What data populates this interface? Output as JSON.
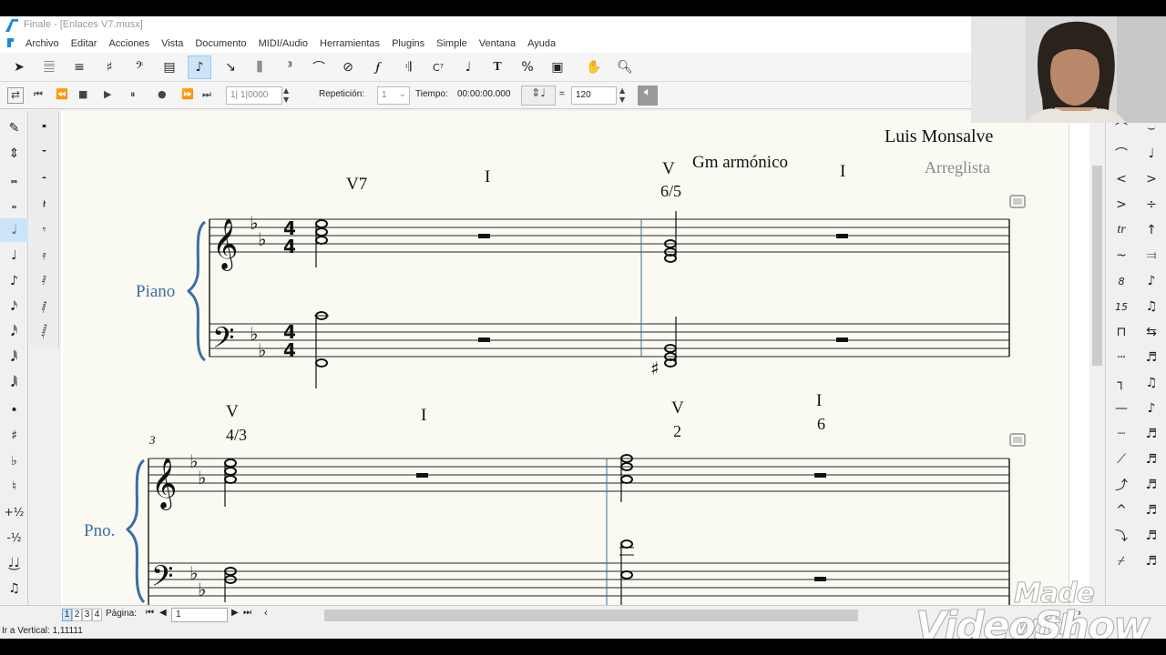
{
  "window": {
    "title": "Finale - [Enlaces V7.musx]"
  },
  "menu": {
    "items": [
      "Archivo",
      "Editar",
      "Acciones",
      "Vista",
      "Documento",
      "MIDI/Audio",
      "Herramientas",
      "Plugins",
      "Simple",
      "Ventana",
      "Ayuda"
    ]
  },
  "playback": {
    "counter": "1| 1|0000",
    "repeat_label": "Repetición:",
    "repeat_value": "1",
    "time_label": "Tiempo:",
    "time_value": "00:00:00.000",
    "equals": "=",
    "tempo": "120"
  },
  "score": {
    "composer": "Luis Monsalve",
    "arranger": "Arreglista",
    "instrument_full": "Piano",
    "instrument_short": "Pno.",
    "measure_number": "3",
    "key_text": "Gm armónico",
    "system1": {
      "chords": [
        {
          "label": "V7",
          "inversion": ""
        },
        {
          "label": "I",
          "inversion": ""
        },
        {
          "label": "V",
          "inversion": "6/5"
        },
        {
          "label": "I",
          "inversion": ""
        }
      ]
    },
    "system2": {
      "chords": [
        {
          "label": "V",
          "inversion": "4/3"
        },
        {
          "label": "I",
          "inversion": ""
        },
        {
          "label": "V",
          "inversion": "2"
        },
        {
          "label": "I",
          "inversion": "6"
        }
      ]
    },
    "time_signature": {
      "top": "4",
      "bottom": "4"
    }
  },
  "status": {
    "pages": [
      "1",
      "2",
      "3",
      "4"
    ],
    "page_label": "Página:",
    "page_value": "1",
    "vertical_info": "Ir a Vertical: 1,11111"
  },
  "watermark": {
    "line1": "Made with",
    "line2": "VideoShow"
  },
  "colors": {
    "accent": "#cce4f7",
    "instrument_name": "#3a6ea5",
    "page": "#fbfaf2"
  }
}
